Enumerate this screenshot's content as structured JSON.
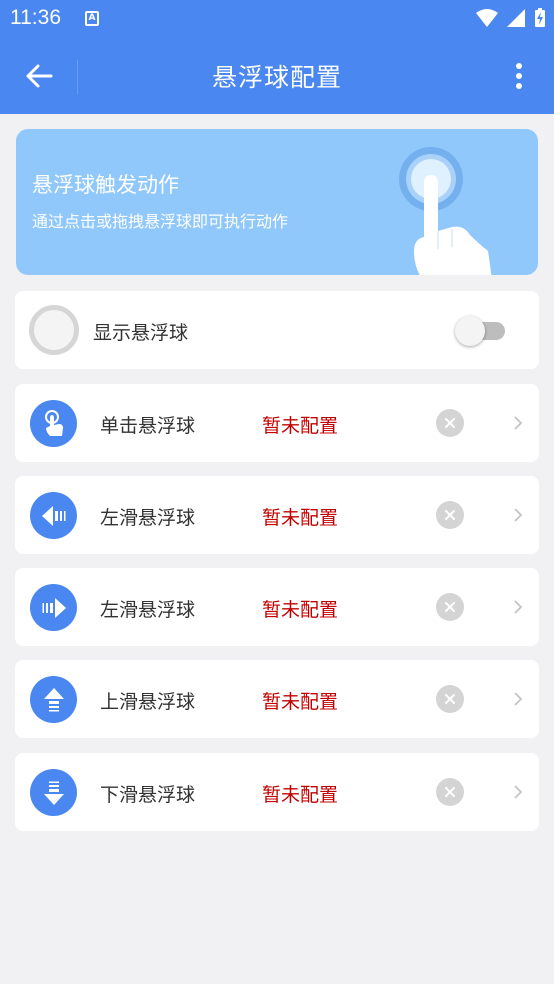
{
  "status_bar": {
    "time": "11:36",
    "notification_badge": "A"
  },
  "app_bar": {
    "title": "悬浮球配置"
  },
  "banner": {
    "title": "悬浮球触发动作",
    "subtitle": "通过点击或拖拽悬浮球即可执行动作"
  },
  "float_toggle": {
    "label": "显示悬浮球",
    "enabled": false
  },
  "actions": [
    {
      "label": "单击悬浮球",
      "status": "暂未配置",
      "icon": "tap-hand-icon"
    },
    {
      "label": "左滑悬浮球",
      "status": "暂未配置",
      "icon": "swipe-left-icon"
    },
    {
      "label": "左滑悬浮球",
      "status": "暂未配置",
      "icon": "swipe-right-icon"
    },
    {
      "label": "上滑悬浮球",
      "status": "暂未配置",
      "icon": "swipe-up-icon"
    },
    {
      "label": "下滑悬浮球",
      "status": "暂未配置",
      "icon": "swipe-down-icon"
    }
  ],
  "colors": {
    "primary": "#4a87f0",
    "banner": "#90c8fb",
    "status_unconfigured": "#c40000",
    "background": "#f1f1f3"
  }
}
